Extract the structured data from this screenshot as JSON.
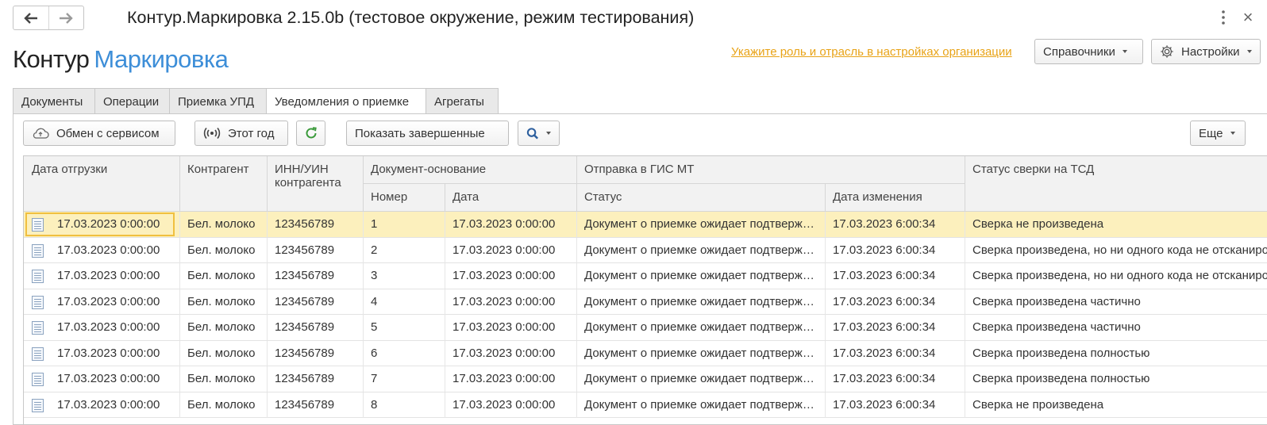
{
  "window": {
    "title": "Контур.Маркировка 2.15.0b (тестовое окружение, режим тестирования)"
  },
  "logo": {
    "part1": "Контур",
    "part2": "Маркировка"
  },
  "header": {
    "hint_link": "Укажите роль и отрасль в настройках организации",
    "reference_label": "Справочники",
    "settings_label": "Настройки"
  },
  "tabs": [
    {
      "label": "Документы",
      "active": false
    },
    {
      "label": "Операции",
      "active": false
    },
    {
      "label": "Приемка УПД",
      "active": false
    },
    {
      "label": "Уведомления о приемке",
      "active": true
    },
    {
      "label": "Агрегаты",
      "active": false
    }
  ],
  "toolbar": {
    "exchange_label": "Обмен с сервисом",
    "period_label": "Этот год",
    "show_completed_label": "Показать завершенные",
    "more_label": "Еще"
  },
  "table": {
    "headers": {
      "ship_date": "Дата отгрузки",
      "counterparty": "Контрагент",
      "inn": "ИНН/УИН контрагента",
      "base_doc": "Документ-основание",
      "number": "Номер",
      "date": "Дата",
      "gis": "Отправка в ГИС МТ",
      "status": "Статус",
      "changed": "Дата изменения",
      "tsd_status": "Статус сверки на ТСД"
    },
    "rows": [
      {
        "ship_date": "17.03.2023 0:00:00",
        "counterparty": "Бел. молоко",
        "inn": "123456789",
        "number": "1",
        "date": "17.03.2023 0:00:00",
        "status": "Документ о приемке ожидает подтверждения",
        "changed": "17.03.2023 6:00:34",
        "tsd_status": "Сверка не произведена"
      },
      {
        "ship_date": "17.03.2023 0:00:00",
        "counterparty": "Бел. молоко",
        "inn": "123456789",
        "number": "2",
        "date": "17.03.2023 0:00:00",
        "status": "Документ о приемке ожидает подтверждения",
        "changed": "17.03.2023 6:00:34",
        "tsd_status": "Сверка произведена, но ни одного кода не отсканировано"
      },
      {
        "ship_date": "17.03.2023 0:00:00",
        "counterparty": "Бел. молоко",
        "inn": "123456789",
        "number": "3",
        "date": "17.03.2023 0:00:00",
        "status": "Документ о приемке ожидает подтверждения",
        "changed": "17.03.2023 6:00:34",
        "tsd_status": "Сверка произведена, но ни одного кода не отсканировано"
      },
      {
        "ship_date": "17.03.2023 0:00:00",
        "counterparty": "Бел. молоко",
        "inn": "123456789",
        "number": "4",
        "date": "17.03.2023 0:00:00",
        "status": "Документ о приемке ожидает подтверждения",
        "changed": "17.03.2023 6:00:34",
        "tsd_status": "Сверка произведена частично"
      },
      {
        "ship_date": "17.03.2023 0:00:00",
        "counterparty": "Бел. молоко",
        "inn": "123456789",
        "number": "5",
        "date": "17.03.2023 0:00:00",
        "status": "Документ о приемке ожидает подтверждения",
        "changed": "17.03.2023 6:00:34",
        "tsd_status": "Сверка произведена частично"
      },
      {
        "ship_date": "17.03.2023 0:00:00",
        "counterparty": "Бел. молоко",
        "inn": "123456789",
        "number": "6",
        "date": "17.03.2023 0:00:00",
        "status": "Документ о приемке ожидает подтверждения",
        "changed": "17.03.2023 6:00:34",
        "tsd_status": "Сверка произведена полностью"
      },
      {
        "ship_date": "17.03.2023 0:00:00",
        "counterparty": "Бел. молоко",
        "inn": "123456789",
        "number": "7",
        "date": "17.03.2023 0:00:00",
        "status": "Документ о приемке ожидает подтверждения",
        "changed": "17.03.2023 6:00:34",
        "tsd_status": "Сверка произведена полностью"
      },
      {
        "ship_date": "17.03.2023 0:00:00",
        "counterparty": "Бел. молоко",
        "inn": "123456789",
        "number": "8",
        "date": "17.03.2023 0:00:00",
        "status": "Документ о приемке ожидает подтверждения",
        "changed": "17.03.2023 6:00:34",
        "tsd_status": "Сверка не произведена"
      }
    ]
  },
  "colors": {
    "hint_link": "#e8a317",
    "logo_accent": "#3d8ed8",
    "selected_row": "#fcf0bd",
    "refresh_icon": "#3a9a3a"
  }
}
